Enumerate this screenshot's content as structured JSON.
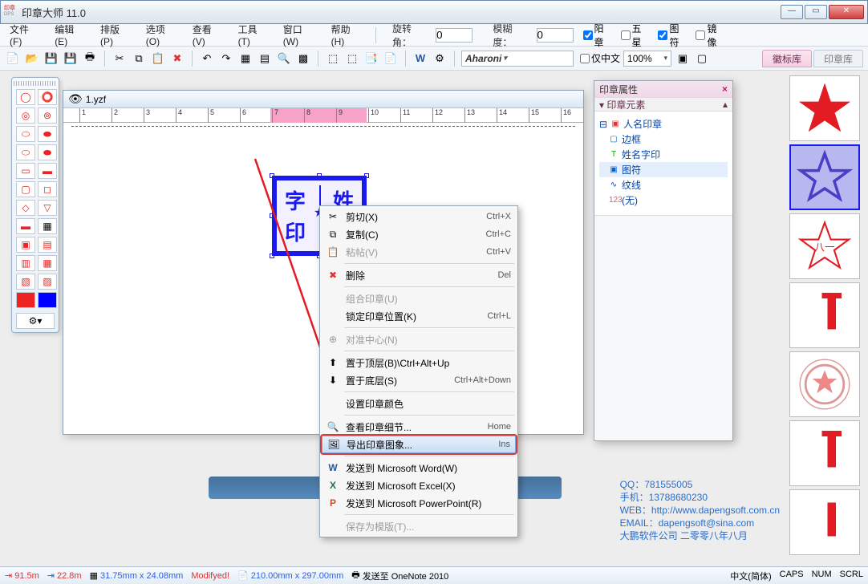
{
  "window": {
    "title": "印章大师 11.0"
  },
  "menu": {
    "file": "文件(F)",
    "edit": "编辑(E)",
    "layout": "排版(P)",
    "options": "选项(O)",
    "view": "查看(V)",
    "tools": "工具(T)",
    "window": "窗口(W)",
    "help": "帮助(H)"
  },
  "toolbar2": {
    "rotate_label": "旋转角：",
    "rotate_value": "0",
    "blur_label": "模糊度：",
    "blur_value": "0",
    "chk_yang": "阳章",
    "chk_wuxing": "五星",
    "chk_tufu": "图符",
    "chk_mirror": "镜像"
  },
  "font": {
    "name": "Aharoni",
    "only_cn": "仅中文",
    "zoom": "100%"
  },
  "right_tabs": {
    "badge_lib": "徽标库",
    "stamp_lib": "印章库"
  },
  "doc": {
    "filename": "1.yzf"
  },
  "stamp": {
    "tl": "字",
    "tr": "姓",
    "bl": "印"
  },
  "ctx": {
    "cut": "剪切(X)",
    "cut_k": "Ctrl+X",
    "copy": "复制(C)",
    "copy_k": "Ctrl+C",
    "paste": "粘帖(V)",
    "paste_k": "Ctrl+V",
    "delete": "删除",
    "delete_k": "Del",
    "group": "组合印章(U)",
    "lock": "锁定印章位置(K)",
    "lock_k": "Ctrl+L",
    "align": "对准中心(N)",
    "top": "置于顶层(B)\\Ctrl+Alt+Up",
    "bottom": "置于底层(S)",
    "bottom_k": "Ctrl+Alt+Down",
    "color": "设置印章颜色",
    "detail": "查看印章细节...",
    "detail_k": "Home",
    "export": "导出印章图象...",
    "export_k": "Ins",
    "word": "发送到 Microsoft Word(W)",
    "excel": "发送到 Microsoft Excel(X)",
    "ppt": "发送到 Microsoft PowerPoint(R)",
    "template": "保存为模版(T)..."
  },
  "prop": {
    "title": "印章属性",
    "section": "印章元素",
    "root": "人名印章",
    "border": "边框",
    "name": "姓名字印",
    "symbol": "图符",
    "texture": "纹线",
    "none": "(无)"
  },
  "footer": {
    "qq_l": "QQ：",
    "qq": "781555005",
    "phone_l": "手机：",
    "phone": "13788680230",
    "web_l": "WEB：",
    "web": "http://www.dapengsoft.com.cn",
    "email_l": "EMAIL：",
    "email": "dapengsoft@sina.com",
    "company": "大鹏软件公司  二零零八年八月"
  },
  "status": {
    "x": "91.5m",
    "y": "22.8m",
    "size": "31.75mm x 24.08mm",
    "modified": "Modifyed!",
    "page": "210.00mm x 297.00mm",
    "send": "发送至 OneNote 2010",
    "ime": "中文(简体)",
    "caps": "CAPS",
    "num": "NUM",
    "scrl": "SCRL"
  }
}
